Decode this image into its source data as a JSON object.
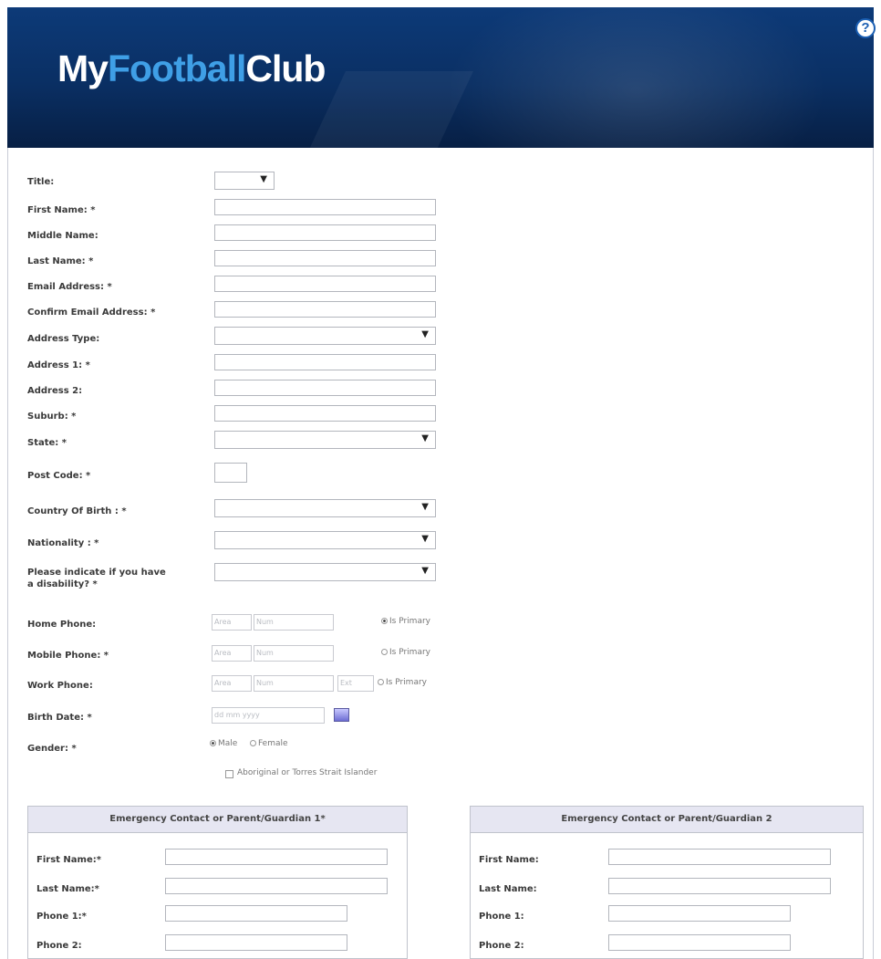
{
  "brand": {
    "my": "My",
    "football": "Football",
    "club": "Club"
  },
  "help_label": "?",
  "form": {
    "title_label": "Title:",
    "first_name_label": "First Name: *",
    "middle_name_label": "Middle Name:",
    "last_name_label": "Last Name: *",
    "email_label": "Email Address: *",
    "confirm_email_label": "Confirm Email Address: *",
    "address_type_label": "Address Type:",
    "address1_label": "Address 1: *",
    "address2_label": "Address 2:",
    "suburb_label": "Suburb: *",
    "state_label": "State: *",
    "post_code_label": "Post Code: *",
    "country_label": "Country Of Birth : *",
    "nationality_label": "Nationality : *",
    "disability_label_1": "Please indicate if you have",
    "disability_label_2": "a disability? *",
    "home_phone_label": "Home Phone:",
    "mobile_phone_label": "Mobile Phone: *",
    "work_phone_label": "Work Phone:",
    "birth_date_label": "Birth Date: *",
    "gender_label": "Gender: *",
    "area_placeholder": "Area",
    "num_placeholder": "Num",
    "ext_placeholder": "Ext",
    "date_placeholder": "dd mm yyyy",
    "is_primary": "Is Primary",
    "male": "Male",
    "female": "Female",
    "aboriginal": "Aboriginal or Torres Strait Islander"
  },
  "contact1": {
    "heading": "Emergency Contact or Parent/Guardian 1*",
    "first_name": "First Name:*",
    "last_name": "Last Name:*",
    "phone1": "Phone 1:*",
    "phone2": "Phone 2:"
  },
  "contact2": {
    "heading": "Emergency Contact or Parent/Guardian 2",
    "first_name": "First Name:",
    "last_name": "Last Name:",
    "phone1": "Phone 1:",
    "phone2": "Phone 2:"
  }
}
